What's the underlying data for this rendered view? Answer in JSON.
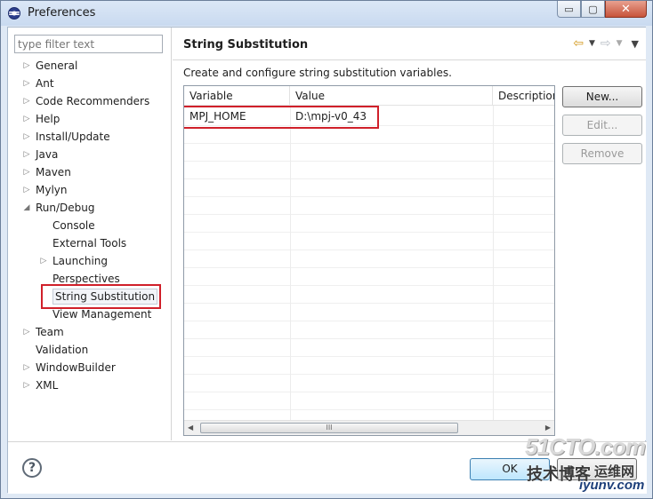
{
  "window": {
    "title": "Preferences",
    "minimize_glyph": "▭",
    "maximize_glyph": "▢",
    "close_glyph": "✕"
  },
  "filter": {
    "placeholder": "type filter text"
  },
  "tree": [
    {
      "label": "General",
      "level": 0,
      "expander": "▷"
    },
    {
      "label": "Ant",
      "level": 0,
      "expander": "▷"
    },
    {
      "label": "Code Recommenders",
      "level": 0,
      "expander": "▷"
    },
    {
      "label": "Help",
      "level": 0,
      "expander": "▷"
    },
    {
      "label": "Install/Update",
      "level": 0,
      "expander": "▷"
    },
    {
      "label": "Java",
      "level": 0,
      "expander": "▷"
    },
    {
      "label": "Maven",
      "level": 0,
      "expander": "▷"
    },
    {
      "label": "Mylyn",
      "level": 0,
      "expander": "▷"
    },
    {
      "label": "Run/Debug",
      "level": 0,
      "expander": "◢"
    },
    {
      "label": "Console",
      "level": 1,
      "expander": ""
    },
    {
      "label": "External Tools",
      "level": 1,
      "expander": ""
    },
    {
      "label": "Launching",
      "level": 1,
      "expander": "▷"
    },
    {
      "label": "Perspectives",
      "level": 1,
      "expander": ""
    },
    {
      "label": "String Substitution",
      "level": 1,
      "expander": "",
      "selected": true
    },
    {
      "label": "View Management",
      "level": 1,
      "expander": ""
    },
    {
      "label": "Team",
      "level": 0,
      "expander": "▷"
    },
    {
      "label": "Validation",
      "level": 0,
      "expander": ""
    },
    {
      "label": "WindowBuilder",
      "level": 0,
      "expander": "▷"
    },
    {
      "label": "XML",
      "level": 0,
      "expander": "▷"
    }
  ],
  "page": {
    "title": "String Substitution",
    "description": "Create and configure string substitution variables.",
    "nav": {
      "back": "⇦",
      "forward": "⇨",
      "caret": "▼",
      "menu": "▼"
    }
  },
  "table": {
    "columns": [
      "Variable",
      "Value",
      "Description"
    ],
    "rows": [
      {
        "variable": "MPJ_HOME",
        "value": "D:\\mpj-v0_43",
        "description": ""
      }
    ],
    "scroll_left": "◀",
    "scroll_right": "▶",
    "scroll_grip": "III"
  },
  "buttons": {
    "new": "New...",
    "edit": "Edit...",
    "remove": "Remove",
    "ok": "OK",
    "help": "?"
  },
  "watermark": {
    "line1": "51CTO.com",
    "line2": "技术博客",
    "line3": "运维网",
    "line4": "iyunv.com"
  },
  "colors": {
    "highlight_box": "#d0202a",
    "ok_border": "#3c7fb1",
    "back_arrow": "#d39a1e"
  }
}
